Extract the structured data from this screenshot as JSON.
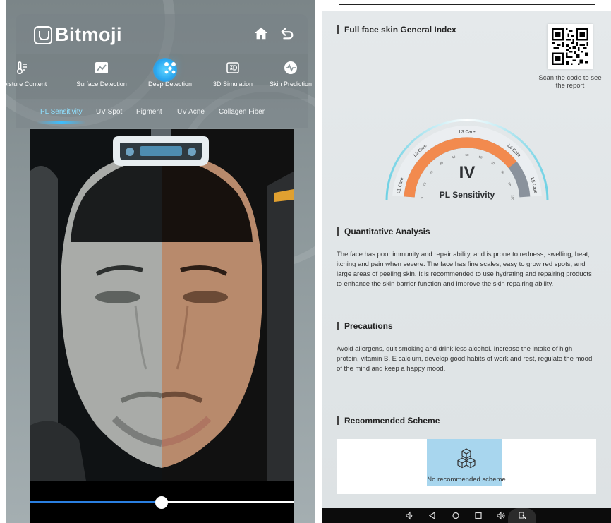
{
  "app": {
    "logo_text": "Bitmoji",
    "home_icon": "home-icon",
    "back_icon": "return-arrow-icon"
  },
  "nav": {
    "items": [
      {
        "label": "Moisture Content",
        "icon": "thermometer-icon"
      },
      {
        "label": "Surface Detection",
        "icon": "image-chart-icon"
      },
      {
        "label": "Deep Detection",
        "icon": "molecule-icon",
        "active": true
      },
      {
        "label": "3D Simulation",
        "icon": "3d-box-icon"
      },
      {
        "label": "Skin Prediction",
        "icon": "pulse-icon"
      }
    ]
  },
  "subtabs": {
    "items": [
      {
        "label": "PL Sensitivity",
        "active": true
      },
      {
        "label": "UV Spot"
      },
      {
        "label": "Pigment"
      },
      {
        "label": "UV Acne"
      },
      {
        "label": "Collagen Fiber"
      }
    ]
  },
  "comparison_slider": {
    "position_fraction": 0.5
  },
  "report": {
    "general_title": "Full face skin General Index",
    "qr_caption": "Scan the code to see the report",
    "gauge": {
      "grade": "IV",
      "metric": "PL Sensitivity",
      "zones": [
        "L1 Care",
        "L2 Care",
        "L3 Care",
        "L4 Care",
        "L5 Care"
      ],
      "ticks": [
        "0",
        "10",
        "20",
        "30",
        "40",
        "50",
        "60",
        "70",
        "80",
        "90",
        "100"
      ],
      "level_fraction": 0.8,
      "colors": {
        "active": "#f28a4e",
        "inactive": "#8a929c",
        "rim": "#6fd1e4"
      }
    },
    "quant_title": "Quantitative Analysis",
    "quant_text": "The face has poor immunity and repair ability, and is prone to redness, swelling, heat, itching and pain when severe. The face has fine scales, easy to grow red spots, and large areas of peeling skin. It is recommended to use hydrating and repairing products to enhance the skin barrier function and improve the skin repairing ability.",
    "precautions_title": "Precautions",
    "precautions_text": "Avoid allergens, quit smoking and drink less alcohol. Increase the intake of high protein, vitamin B, E calcium, develop good habits of work and rest, regulate the mood of the mind and keep a happy mood.",
    "scheme_title": "Recommended Scheme",
    "scheme_empty": "No recommended scheme"
  },
  "sysbar": {
    "icons": [
      "volume-down-icon",
      "back-triangle-icon",
      "home-circle-icon",
      "recents-square-icon",
      "volume-up-icon",
      "screenshot-icon"
    ]
  },
  "colors": {
    "accent": "#3cbeff",
    "slider_fill": "#2a7fe0"
  }
}
